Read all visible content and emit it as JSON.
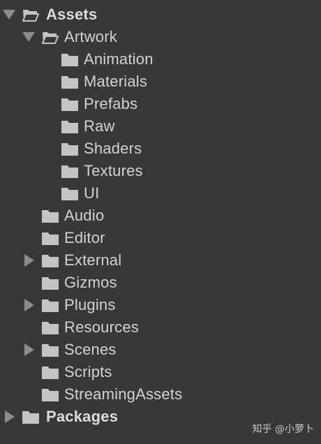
{
  "project_tree": {
    "items": [
      {
        "label": "Assets",
        "expanded": true,
        "has_children": true,
        "bold": true,
        "icon": "folder-open-icon"
      },
      {
        "label": "Artwork",
        "expanded": true,
        "has_children": true,
        "bold": false,
        "icon": "folder-open-icon"
      },
      {
        "label": "Animation",
        "has_children": false,
        "icon": "folder-icon"
      },
      {
        "label": "Materials",
        "has_children": false,
        "icon": "folder-icon"
      },
      {
        "label": "Prefabs",
        "has_children": false,
        "icon": "folder-icon"
      },
      {
        "label": "Raw",
        "has_children": false,
        "icon": "folder-icon"
      },
      {
        "label": "Shaders",
        "has_children": false,
        "icon": "folder-icon"
      },
      {
        "label": "Textures",
        "has_children": false,
        "icon": "folder-icon"
      },
      {
        "label": "UI",
        "has_children": false,
        "icon": "folder-icon"
      },
      {
        "label": "Audio",
        "has_children": false,
        "icon": "folder-icon"
      },
      {
        "label": "Editor",
        "has_children": false,
        "icon": "folder-icon"
      },
      {
        "label": "External",
        "expanded": false,
        "has_children": true,
        "icon": "folder-icon"
      },
      {
        "label": "Gizmos",
        "has_children": false,
        "icon": "folder-icon"
      },
      {
        "label": "Plugins",
        "expanded": false,
        "has_children": true,
        "icon": "folder-icon"
      },
      {
        "label": "Resources",
        "has_children": false,
        "icon": "folder-icon"
      },
      {
        "label": "Scenes",
        "expanded": false,
        "has_children": true,
        "icon": "folder-icon"
      },
      {
        "label": "Scripts",
        "has_children": false,
        "icon": "folder-icon"
      },
      {
        "label": "StreamingAssets",
        "has_children": false,
        "icon": "folder-icon"
      },
      {
        "label": "Packages",
        "expanded": false,
        "has_children": true,
        "bold": true,
        "icon": "folder-icon"
      }
    ]
  },
  "watermark": {
    "text": "知乎 @小萝卜"
  },
  "colors": {
    "background": "#383838",
    "text": "#d2d2d2",
    "arrow": "#8c8c8c",
    "folder": "#c4c4c4"
  }
}
